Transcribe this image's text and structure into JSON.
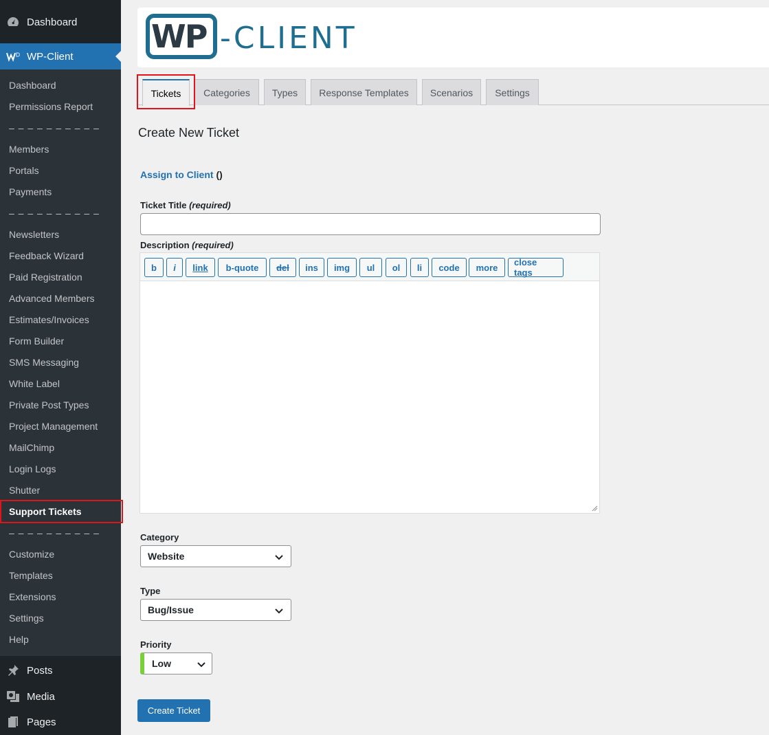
{
  "sidebar": {
    "top": [
      {
        "label": "Dashboard",
        "icon": "dashboard-icon"
      },
      {
        "label": "WP-Client",
        "icon": "wp-client-icon"
      }
    ],
    "submenu": {
      "items": [
        "Dashboard",
        "Permissions Report",
        "Members",
        "Portals",
        "Payments",
        "Newsletters",
        "Feedback Wizard",
        "Paid Registration",
        "Advanced Members",
        "Estimates/Invoices",
        "Form Builder",
        "SMS Messaging",
        "White Label",
        "Private Post Types",
        "Project Management",
        "MailChimp",
        "Login Logs",
        "Shutter",
        "Support Tickets",
        "Customize",
        "Templates",
        "Extensions",
        "Settings",
        "Help"
      ],
      "separator": "– – – – – – – – – –"
    },
    "bottom": [
      {
        "label": "Posts",
        "icon": "pin-icon"
      },
      {
        "label": "Media",
        "icon": "media-icon"
      },
      {
        "label": "Pages",
        "icon": "pages-icon"
      }
    ]
  },
  "logo": {
    "wp": "WP",
    "client": "-CLIENT"
  },
  "tabs": [
    "Tickets",
    "Categories",
    "Types",
    "Response Templates",
    "Scenarios",
    "Settings"
  ],
  "form": {
    "heading": "Create New Ticket",
    "assign_link": "Assign to Client",
    "assign_paren": " ()",
    "title_label": "Ticket Title",
    "title_req": "(required)",
    "title_value": "",
    "desc_label": "Description",
    "desc_req": "(required)",
    "quicktags": [
      "b",
      "i",
      "link",
      "b-quote",
      "del",
      "ins",
      "img",
      "ul",
      "ol",
      "li",
      "code",
      "more",
      "close tags"
    ],
    "category_label": "Category",
    "category_value": "Website",
    "type_label": "Type",
    "type_value": "Bug/Issue",
    "priority_label": "Priority",
    "priority_value": "Low",
    "priority_color": "#7ad03a",
    "submit": "Create Ticket"
  },
  "colors": {
    "accent": "#2271b1",
    "highlight": "#e1141b",
    "sidebar": "#1d2327"
  }
}
